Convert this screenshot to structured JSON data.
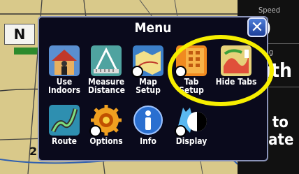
{
  "map": {
    "north_label": "N",
    "scale_label": "2"
  },
  "fields": [
    {
      "label": "Speed",
      "value": "0"
    },
    {
      "label": "ving",
      "value": "uth"
    },
    {
      "label": "",
      "value": "y to"
    },
    {
      "label": "",
      "value": "gate"
    }
  ],
  "menu": {
    "title": "Menu",
    "close_label": "✕",
    "items": [
      {
        "label": "Use\nIndoors",
        "icon": "house-person-icon"
      },
      {
        "label": "Measure\nDistance",
        "icon": "measure-distance-icon"
      },
      {
        "label": "Map\nSetup",
        "icon": "map-setup-icon"
      },
      {
        "label": "Tab\nSetup",
        "icon": "tab-setup-icon"
      },
      {
        "label": "Hide Tabs",
        "icon": "hide-tabs-icon"
      },
      {
        "label": "Route",
        "icon": "route-icon"
      },
      {
        "label": "Options",
        "icon": "options-gear-icon"
      },
      {
        "label": "Info",
        "icon": "info-icon"
      },
      {
        "label": "Display",
        "icon": "display-icon"
      }
    ]
  },
  "colors": {
    "highlight": "#f7ef00",
    "menu_bg": "#0a0a1c",
    "map_bg": "#d9c98a"
  }
}
